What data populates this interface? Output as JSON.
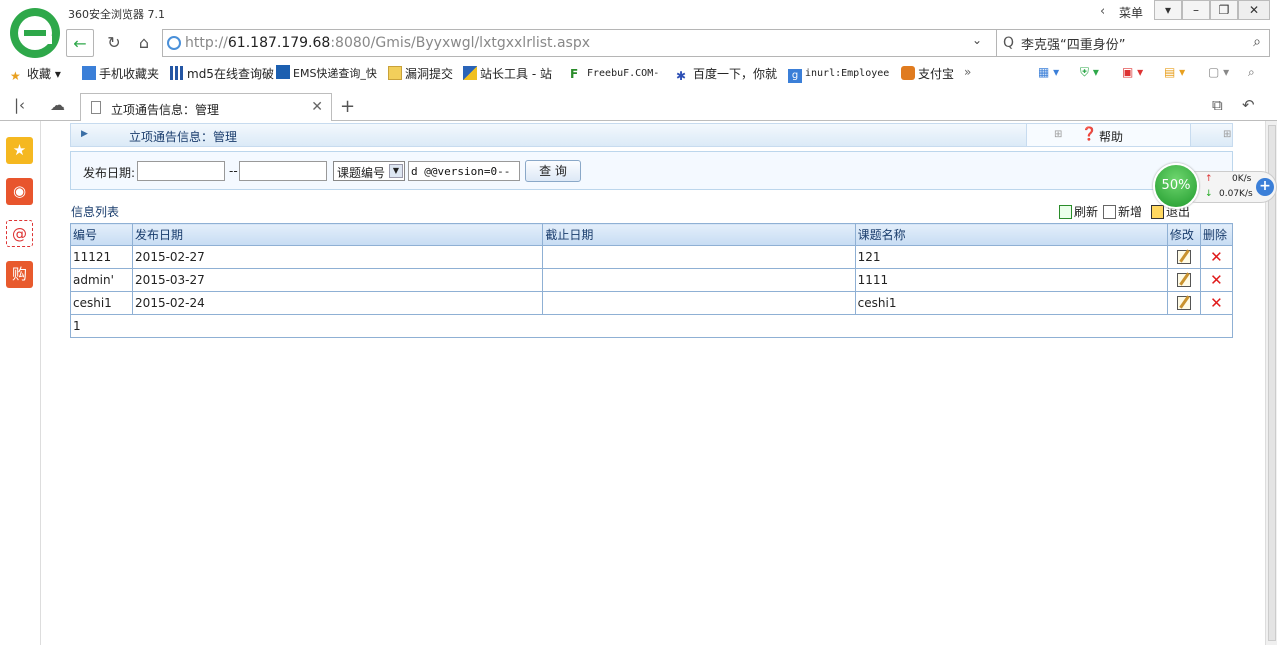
{
  "browser": {
    "title": "360安全浏览器 7.1",
    "menu_label": "菜单",
    "url_host": "http://",
    "url_ip": "61.187.179.68",
    "url_rest": ":8080/Gmis/Byyxwgl/lxtgxxlrlist.aspx",
    "search_text": "李克强“四重身份”",
    "tab_title": "立项通告信息：管理"
  },
  "bookmarks": [
    {
      "label": "收藏",
      "icon": "star-icon"
    },
    {
      "label": "手机收藏夹",
      "icon": "phone-icon"
    },
    {
      "label": "md5在线查询破",
      "icon": "grid-icon"
    },
    {
      "label": "EMS快递查询_快",
      "icon": "ems-icon"
    },
    {
      "label": "漏洞提交",
      "icon": "folder-icon"
    },
    {
      "label": "站长工具 - 站",
      "icon": "tool-icon"
    },
    {
      "label": "FreebuF.COM-",
      "icon": "f-icon"
    },
    {
      "label": "百度一下，你就",
      "icon": "paw-icon"
    },
    {
      "label": "inurl:Employee",
      "icon": "google-icon"
    },
    {
      "label": "支付宝",
      "icon": "shield-icon"
    }
  ],
  "page": {
    "header_title": "立项通告信息：管理",
    "help_label": "帮助",
    "search": {
      "date_label": "发布日期:",
      "date_from": "",
      "date_sep": "--",
      "date_to": "",
      "field_select": "课题编号",
      "keyword": "d @@version=0--",
      "query_button": "查 询"
    },
    "list_label": "信息列表",
    "actions": {
      "refresh": "刷新",
      "add": "新增",
      "exit": "退出"
    },
    "table": {
      "headers": [
        "编号",
        "发布日期",
        "截止日期",
        "课题名称",
        "修改",
        "删除"
      ],
      "rows": [
        {
          "id": "11121",
          "pub_date": "2015-02-27",
          "end_date": "",
          "name": "121"
        },
        {
          "id": "admin'",
          "pub_date": "2015-03-27",
          "end_date": "",
          "name": "1111"
        },
        {
          "id": "ceshi1",
          "pub_date": "2015-02-24",
          "end_date": "",
          "name": "ceshi1"
        }
      ],
      "pager": "1"
    }
  },
  "speed_widget": {
    "percent": "50%",
    "upload": "0K/s",
    "download": "0.07K/s"
  }
}
